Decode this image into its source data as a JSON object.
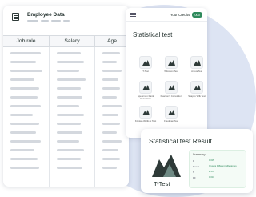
{
  "employee_card": {
    "title": "Employee Data",
    "columns": [
      "Job role",
      "Salary",
      "Age"
    ],
    "row_count": 14
  },
  "stat_panel": {
    "credits_label": "Your Credits",
    "credits_value": "000",
    "title": "Statistical test",
    "tests": [
      {
        "label": "T-Test"
      },
      {
        "label": "Wilcoxon Test"
      },
      {
        "label": "Anova Test"
      },
      {
        "label": "Spearman Rank Correlation"
      },
      {
        "label": "Pearson's Correlation"
      },
      {
        "label": "Shapiro Wilk Test"
      },
      {
        "label": "Kruskal-Wallis H Test"
      },
      {
        "label": "Friedman Test"
      }
    ]
  },
  "result_card": {
    "title": "Statistical test Result",
    "test_name": "T-Test",
    "summary": {
      "heading": "Summary",
      "rows": [
        {
          "key": "P",
          "value": "0.035"
        },
        {
          "key": "Result",
          "value": "Groups Different Milestones"
        },
        {
          "key": "T",
          "value": "2.551"
        },
        {
          "key": "DF",
          "value": "0.034"
        }
      ]
    }
  },
  "colors": {
    "accent_green": "#2f8a5c",
    "chart_dark": "#2e3a38",
    "background_blob": "#dde4f3"
  },
  "icons": [
    "document-icon",
    "menu-icon",
    "chart-icon"
  ]
}
